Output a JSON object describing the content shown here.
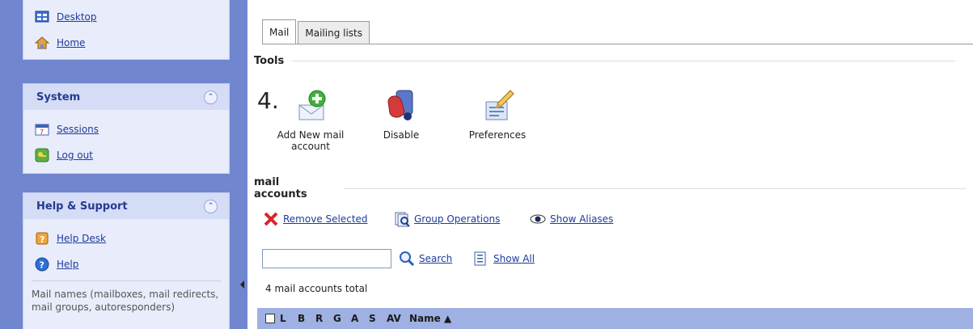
{
  "sidebar": {
    "nav": [
      {
        "label": "Desktop",
        "icon": "desktop-icon"
      },
      {
        "label": "Home",
        "icon": "home-icon"
      }
    ],
    "system": {
      "title": "System",
      "items": [
        {
          "label": "Sessions",
          "icon": "sessions-icon"
        },
        {
          "label": "Log out",
          "icon": "logout-icon"
        }
      ]
    },
    "help": {
      "title": "Help & Support",
      "items": [
        {
          "label": "Help Desk",
          "icon": "help-desk-icon"
        },
        {
          "label": "Help",
          "icon": "help-icon"
        }
      ],
      "description": "Mail names (mailboxes, mail redirects, mail groups, autoresponders)"
    }
  },
  "tabs": [
    {
      "label": "Mail",
      "active": true
    },
    {
      "label": "Mailing lists",
      "active": false
    }
  ],
  "tools": {
    "title": "Tools",
    "annotation": "4.",
    "items": [
      {
        "label": "Add New mail account",
        "icon": "add-mail-icon"
      },
      {
        "label": "Disable",
        "icon": "disable-icon"
      },
      {
        "label": "Preferences",
        "icon": "preferences-icon"
      }
    ]
  },
  "mail_accounts": {
    "title": "mail accounts",
    "actions": {
      "remove_selected": "Remove Selected",
      "group_operations": "Group Operations",
      "show_aliases": "Show Aliases"
    },
    "search": {
      "value": "",
      "placeholder": "",
      "search_label": "Search",
      "show_all_label": "Show All"
    },
    "total": "4 mail accounts total",
    "columns": [
      "L",
      "B",
      "R",
      "G",
      "A",
      "S",
      "AV",
      "Name ▲"
    ]
  },
  "colors": {
    "sidebar_band": "#7086cf",
    "panel_bg": "#e9ecfb",
    "panel_header": "#d5dcf6",
    "table_header": "#9fb0e3",
    "link": "#1d3c9c"
  }
}
